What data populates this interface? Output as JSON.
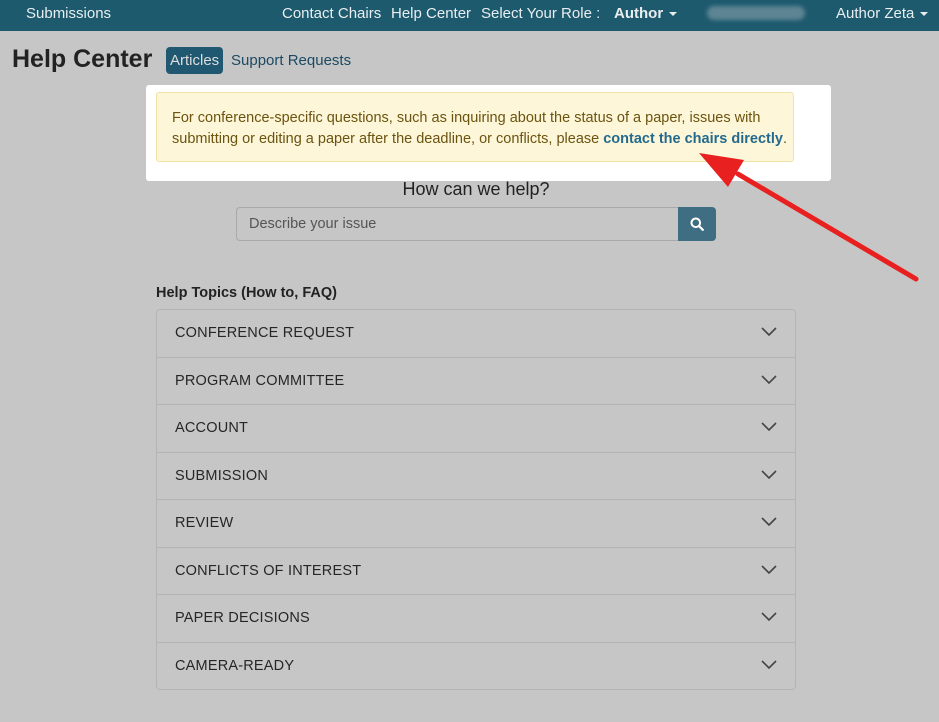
{
  "navbar": {
    "submissions": "Submissions",
    "contact_chairs": "Contact Chairs",
    "help_center": "Help Center",
    "select_role_label": "Select Your Role :",
    "role_value": "Author",
    "user_name": "Author Zeta"
  },
  "page": {
    "title": "Help Center",
    "tabs": [
      {
        "label": "Articles",
        "active": true
      },
      {
        "label": "Support Requests",
        "active": false
      }
    ]
  },
  "alert": {
    "text": "For conference-specific questions, such as inquiring about the status of a paper, issues with submitting or editing a paper after the deadline, or conflicts, please ",
    "link_text": "contact the chairs directly",
    "suffix": "."
  },
  "help": {
    "heading": "How can we help?",
    "search_placeholder": "Describe your issue"
  },
  "topics": {
    "heading": "Help Topics (How to, FAQ)",
    "items": [
      "CONFERENCE REQUEST",
      "PROGRAM COMMITTEE",
      "ACCOUNT",
      "SUBMISSION",
      "REVIEW",
      "CONFLICTS OF INTEREST",
      "PAPER DECISIONS",
      "CAMERA-READY"
    ]
  },
  "colors": {
    "navbar": "#1d5a6e",
    "accent_link": "#246a8e",
    "alert_bg": "#fdf6d8",
    "annotation_arrow": "#e8201f"
  },
  "icons": {
    "search": "search-icon",
    "chevron": "chevron-down-icon",
    "caret": "caret-down-icon"
  }
}
